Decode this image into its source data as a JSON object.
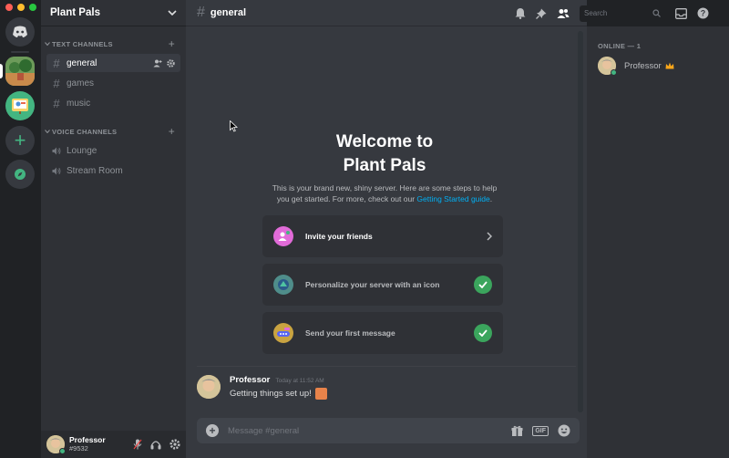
{
  "window": {
    "traffic_lights": [
      "#ff5f57",
      "#febc2e",
      "#28c840"
    ]
  },
  "server": {
    "name": "Plant Pals"
  },
  "sidebar": {
    "text_category": "TEXT CHANNELS",
    "voice_category": "VOICE CHANNELS",
    "text_channels": [
      {
        "label": "general",
        "active": true
      },
      {
        "label": "games",
        "active": false
      },
      {
        "label": "music",
        "active": false
      }
    ],
    "voice_channels": [
      {
        "label": "Lounge"
      },
      {
        "label": "Stream Room"
      }
    ]
  },
  "user": {
    "name": "Professor",
    "tag": "#9532"
  },
  "chat": {
    "channel": "general",
    "welcome_title_line1": "Welcome to",
    "welcome_title_line2": "Plant Pals",
    "welcome_desc_line1": "This is your brand new, shiny server. Here are some steps to help",
    "welcome_desc_line2_prefix": "you get started. For more, check out our ",
    "welcome_desc_link": "Getting Started guide",
    "welcome_desc_suffix": ".",
    "cards": [
      {
        "label": "Invite your friends",
        "done": false,
        "icon": "invite-icon"
      },
      {
        "label": "Personalize your server with an icon",
        "done": true,
        "icon": "server-icon-illustration"
      },
      {
        "label": "Send your first message",
        "done": true,
        "icon": "message-illustration"
      }
    ],
    "message": {
      "author": "Professor",
      "time": "Today at 11:52 AM",
      "text": "Getting things set up!"
    },
    "composer_placeholder": "Message #general"
  },
  "toolbar": {
    "search_placeholder": "Search"
  },
  "members": {
    "section": "ONLINE — 1",
    "list": [
      {
        "name": "Professor"
      }
    ]
  },
  "colors": {
    "accent": "#7289da",
    "online": "#43b581",
    "link": "#00b0f4",
    "check": "#3ba55d"
  }
}
